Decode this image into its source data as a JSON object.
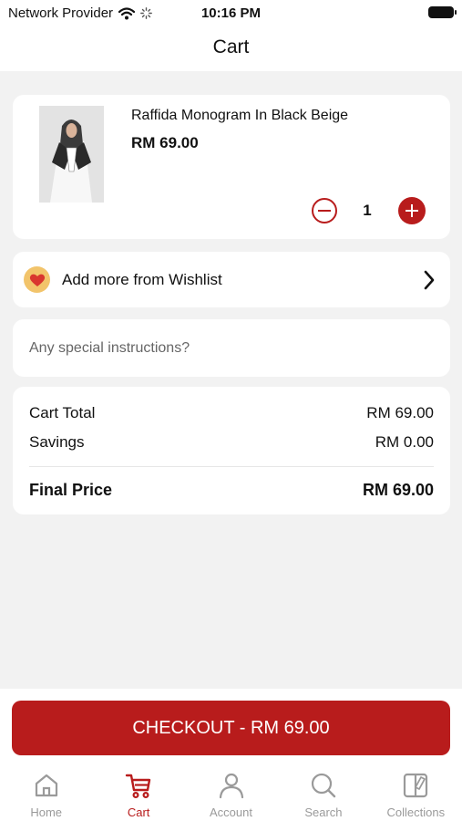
{
  "status_bar": {
    "carrier": "Network Provider",
    "time": "10:16 PM",
    "icons": [
      "wifi-icon",
      "activity-spinner-icon",
      "battery-icon"
    ]
  },
  "header": {
    "title": "Cart"
  },
  "cart_item": {
    "name": "Raffida Monogram In Black Beige",
    "price": "RM 69.00",
    "quantity": "1",
    "icons": [
      "minus-circle-icon",
      "plus-circle-icon"
    ]
  },
  "wishlist": {
    "label": "Add more from Wishlist",
    "icons": [
      "heart-icon",
      "chevron-right-icon"
    ]
  },
  "instructions": {
    "placeholder": "Any special instructions?",
    "value": ""
  },
  "summary": {
    "cart_total_label": "Cart Total",
    "cart_total_value": "RM 69.00",
    "savings_label": "Savings",
    "savings_value": "RM 0.00",
    "final_label": "Final Price",
    "final_value": "RM 69.00"
  },
  "checkout": {
    "label": "CHECKOUT - RM 69.00"
  },
  "tabs": [
    {
      "label": "Home",
      "icon": "home-icon",
      "active": false
    },
    {
      "label": "Cart",
      "icon": "cart-icon",
      "active": true
    },
    {
      "label": "Account",
      "icon": "account-icon",
      "active": false
    },
    {
      "label": "Search",
      "icon": "search-icon",
      "active": false
    },
    {
      "label": "Collections",
      "icon": "collections-icon",
      "active": false
    }
  ],
  "colors": {
    "accent": "#b81c1c",
    "background": "#f2f2f2",
    "card": "#ffffff",
    "inactive_tab": "#9a9a9a",
    "heart_badge": "#f2c46b"
  }
}
